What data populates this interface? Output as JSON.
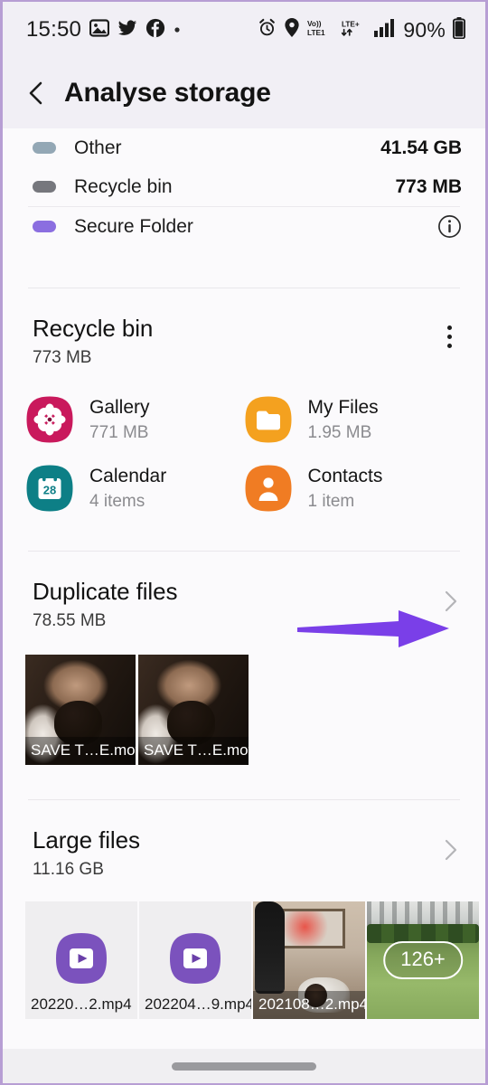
{
  "status_bar": {
    "time": "15:50",
    "battery_percent": "90%",
    "left_icons": [
      "gallery-icon",
      "twitter-icon",
      "facebook-icon",
      "dot-icon"
    ],
    "right_icons": [
      "alarm-icon",
      "location-icon",
      "volte-lte1-icon",
      "lte-plus-icon",
      "signal-bars-icon",
      "battery-icon"
    ],
    "network_primary": "Vo))",
    "network_secondary": "LTE1",
    "network_tertiary": "LTE+"
  },
  "app_bar": {
    "back_icon": "back-chevron-icon",
    "title": "Analyse storage"
  },
  "legend": {
    "rows": [
      {
        "label": "Other",
        "value": "41.54 GB",
        "color": "#93a7b5",
        "trailing": "value"
      },
      {
        "label": "Recycle bin",
        "value": "773 MB",
        "color": "#76777d",
        "trailing": "value"
      },
      {
        "label": "Secure Folder",
        "value": "",
        "color": "#8b6ee0",
        "trailing": "info"
      }
    ]
  },
  "recycle_bin": {
    "title": "Recycle bin",
    "subtitle": "773 MB",
    "menu_icon": "kebab-menu-icon",
    "apps": [
      {
        "name": "Gallery",
        "detail": "771 MB",
        "icon": "gallery-app-icon",
        "color": "#c9195c"
      },
      {
        "name": "My Files",
        "detail": "1.95 MB",
        "icon": "myfiles-app-icon",
        "color": "#f4a11f"
      },
      {
        "name": "Calendar",
        "detail": "4 items",
        "icon": "calendar-app-icon",
        "color": "#0d7f86"
      },
      {
        "name": "Contacts",
        "detail": "1 item",
        "icon": "contacts-app-icon",
        "color": "#f07c23"
      }
    ]
  },
  "duplicate_files": {
    "title": "Duplicate files",
    "subtitle": "78.55 MB",
    "chevron_icon": "chevron-right-icon",
    "thumbnails": [
      {
        "caption": "SAVE T…E.mov",
        "scene": "man-portrait"
      },
      {
        "caption": "SAVE T…E.mov",
        "scene": "man-portrait"
      }
    ]
  },
  "large_files": {
    "title": "Large files",
    "subtitle": "11.16 GB",
    "chevron_icon": "chevron-right-icon",
    "thumbnails": [
      {
        "caption": "20220…2.mp4",
        "scene": "video-placeholder"
      },
      {
        "caption": "202204…9.mp4",
        "scene": "video-placeholder"
      },
      {
        "caption": "202108…2.mp4",
        "scene": "room-photo"
      },
      {
        "caption": "",
        "scene": "lawn-photo",
        "badge": "126+"
      }
    ]
  },
  "annotation": {
    "arrow_color": "#7a3fe8",
    "points_to": "duplicate-files-chevron"
  },
  "nav_bar": {
    "home_indicator": "gesture-pill"
  },
  "colors": {
    "header_bg": "#f1eff5",
    "content_bg": "#fbfafc",
    "accent_purple": "#7a3fe8",
    "device_frame": "#b79ed4"
  }
}
